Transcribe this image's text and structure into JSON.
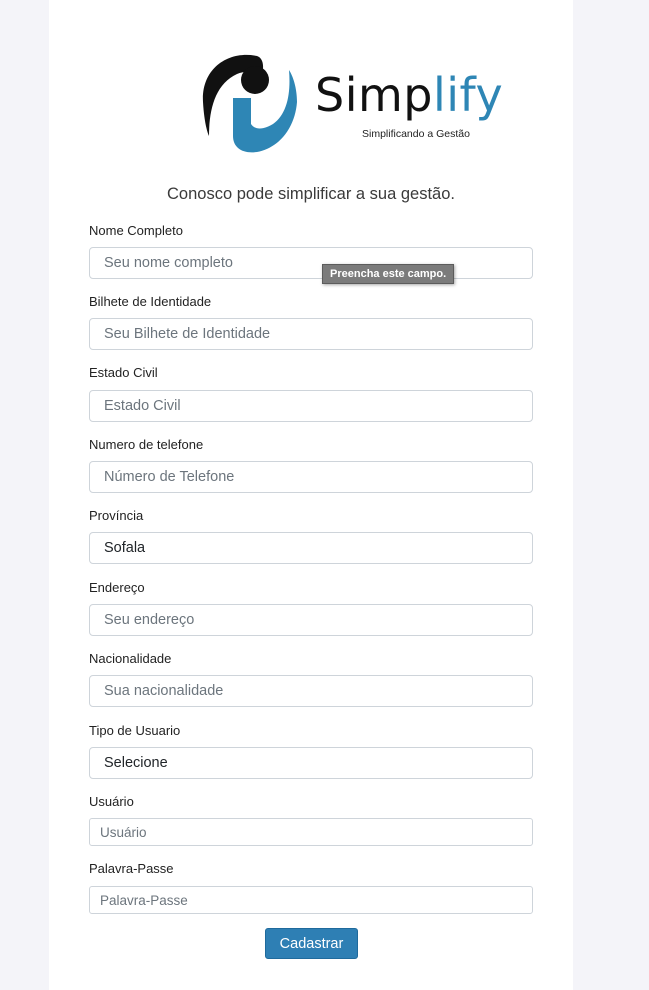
{
  "brand": {
    "name_prefix": "Simp",
    "name_highlight": "lify",
    "tagline": "Simplificando a Gestão",
    "colors": {
      "dark": "#111111",
      "accent": "#2e86b5"
    }
  },
  "subtitle": "Conosco pode simplificar a sua gestão.",
  "tooltip": "Preencha este campo.",
  "fields": {
    "nome": {
      "label": "Nome Completo",
      "placeholder": "Seu nome completo"
    },
    "bilhete": {
      "label": "Bilhete de Identidade",
      "placeholder": "Seu Bilhete de Identidade"
    },
    "estado_civil": {
      "label": "Estado Civil",
      "placeholder": "Estado Civil"
    },
    "telefone": {
      "label": "Numero de telefone",
      "placeholder": "Número de Telefone"
    },
    "provincia": {
      "label": "Província",
      "value": "Sofala"
    },
    "endereco": {
      "label": "Endereço",
      "placeholder": "Seu endereço"
    },
    "nacionalidade": {
      "label": "Nacionalidade",
      "placeholder": "Sua nacionalidade"
    },
    "tipo_usuario": {
      "label": "Tipo de Usuario",
      "value": "Selecione"
    },
    "usuario": {
      "label": "Usuário",
      "placeholder": "Usuário"
    },
    "senha": {
      "label": "Palavra-Passe",
      "placeholder": "Palavra-Passe"
    }
  },
  "submit_label": "Cadastrar",
  "button_color": "#2e7fb4"
}
